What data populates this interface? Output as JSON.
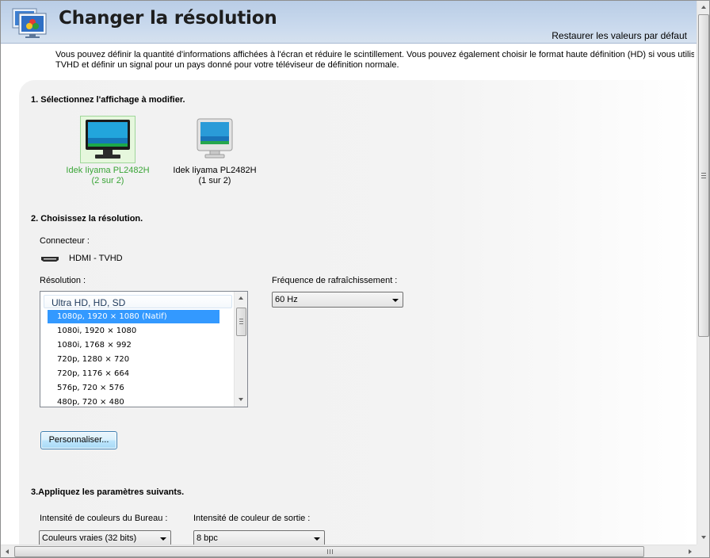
{
  "header": {
    "title": "Changer la résolution",
    "restore_link": "Restaurer les valeurs par défaut",
    "icon": "display-settings-icon"
  },
  "intro": {
    "line1": "Vous pouvez définir la quantité d'informations affichées à l'écran et réduire le scintillement. Vous pouvez également choisir le format haute définition (HD) si vous utilisez un é",
    "line2": "TVHD et définir un signal pour un pays donné pour votre téléviseur de définition normale."
  },
  "step1": {
    "title": "1. Sélectionnez l'affichage à modifier.",
    "monitors": [
      {
        "name": "Idek Iiyama PL2482H",
        "sub": "(2 sur 2)",
        "selected": true
      },
      {
        "name": "Idek Iiyama PL2482H",
        "sub": "(1 sur 2)",
        "selected": false
      }
    ]
  },
  "step2": {
    "title": "2. Choisissez la résolution.",
    "connector_label": "Connecteur :",
    "connector_value": "HDMI - TVHD",
    "resolution_label": "Résolution :",
    "group": "Ultra HD, HD, SD",
    "resolutions": [
      "1080p, 1920 × 1080 (Natif)",
      "1080i, 1920 × 1080",
      "1080i, 1768 × 992",
      "720p, 1280 × 720",
      "720p, 1176 × 664",
      "576p, 720 × 576",
      "480p, 720 × 480"
    ],
    "selected_index": 0,
    "refresh_label": "Fréquence de rafraîchissement :",
    "refresh_value": "60 Hz",
    "custom_button": "Personnaliser..."
  },
  "step3": {
    "title": "3.Appliquez les paramètres suivants.",
    "desktop_depth_label": "Intensité de couleurs du Bureau :",
    "desktop_depth_value": "Couleurs vraies (32 bits)",
    "output_depth_label": "Intensité de couleur de sortie :",
    "output_depth_value": "8 bpc"
  },
  "colors": {
    "header_bg": "#c6d7ec",
    "selected_item": "#3399ff",
    "selected_monitor_text": "#3aa537"
  }
}
